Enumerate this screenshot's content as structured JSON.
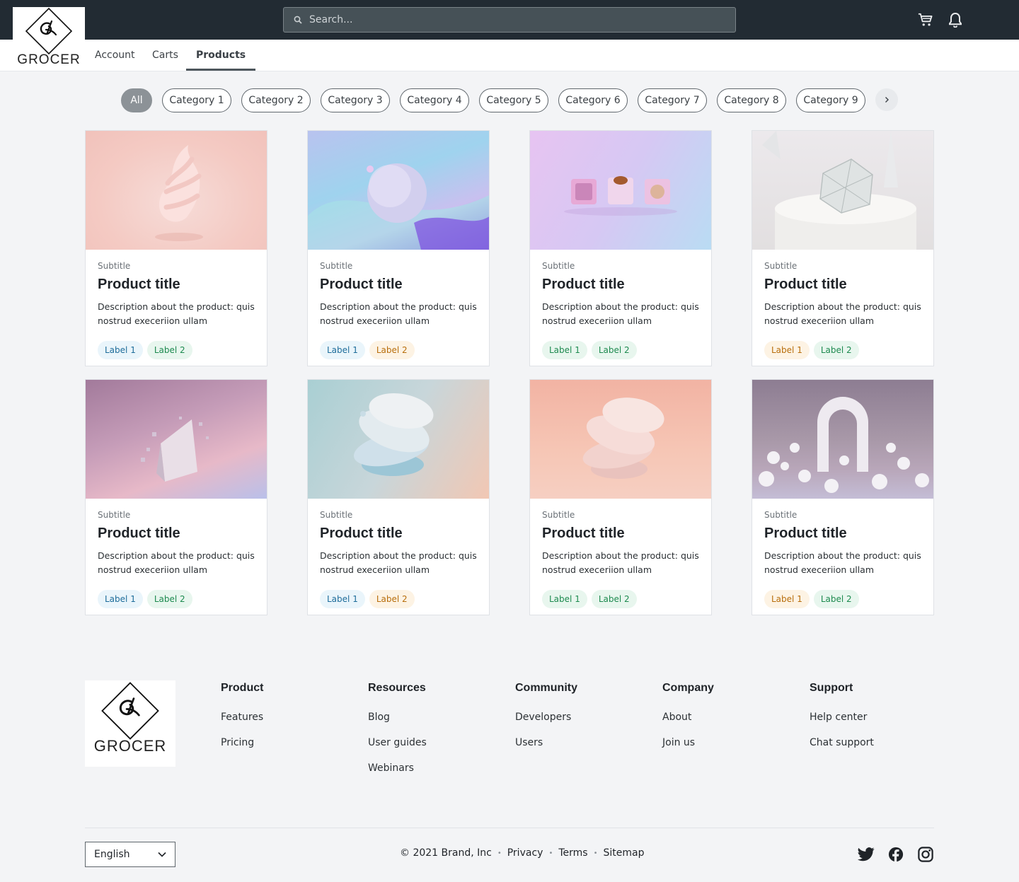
{
  "header": {
    "logo_text": "GROCER",
    "search_placeholder": "Search...",
    "icons": [
      "cart-icon",
      "bell-icon"
    ]
  },
  "nav": {
    "tabs": [
      {
        "label": "Account",
        "active": false
      },
      {
        "label": "Carts",
        "active": false
      },
      {
        "label": "Products",
        "active": true
      }
    ]
  },
  "categories": {
    "items": [
      {
        "label": "All",
        "active": true
      },
      {
        "label": "Category 1"
      },
      {
        "label": "Category 2"
      },
      {
        "label": "Category 3"
      },
      {
        "label": "Category 4"
      },
      {
        "label": "Category 5"
      },
      {
        "label": "Category 6"
      },
      {
        "label": "Category 7"
      },
      {
        "label": "Category 8"
      },
      {
        "label": "Category 9"
      }
    ],
    "next_icon": "chevron-right-icon"
  },
  "products": [
    {
      "subtitle": "Subtitle",
      "title": "Product title",
      "description": "Description about the product: quis nostrud execeriion ullam",
      "labels": [
        {
          "text": "Label 1",
          "color": "blue"
        },
        {
          "text": "Label 2",
          "color": "green"
        }
      ]
    },
    {
      "subtitle": "Subtitle",
      "title": "Product title",
      "description": "Description about the product: quis nostrud execeriion ullam",
      "labels": [
        {
          "text": "Label 1",
          "color": "blue"
        },
        {
          "text": "Label 2",
          "color": "orange"
        }
      ]
    },
    {
      "subtitle": "Subtitle",
      "title": "Product title",
      "description": "Description about the product: quis nostrud execeriion ullam",
      "labels": [
        {
          "text": "Label 1",
          "color": "green"
        },
        {
          "text": "Label 2",
          "color": "green"
        }
      ]
    },
    {
      "subtitle": "Subtitle",
      "title": "Product title",
      "description": "Description about the product: quis nostrud execeriion ullam",
      "labels": [
        {
          "text": "Label 1",
          "color": "orange"
        },
        {
          "text": "Label 2",
          "color": "green"
        }
      ]
    },
    {
      "subtitle": "Subtitle",
      "title": "Product title",
      "description": "Description about the product: quis nostrud execeriion ullam",
      "labels": [
        {
          "text": "Label 1",
          "color": "blue"
        },
        {
          "text": "Label 2",
          "color": "green"
        }
      ]
    },
    {
      "subtitle": "Subtitle",
      "title": "Product title",
      "description": "Description about the product: quis nostrud execeriion ullam",
      "labels": [
        {
          "text": "Label 1",
          "color": "blue"
        },
        {
          "text": "Label 2",
          "color": "orange"
        }
      ]
    },
    {
      "subtitle": "Subtitle",
      "title": "Product title",
      "description": "Description about the product: quis nostrud execeriion ullam",
      "labels": [
        {
          "text": "Label 1",
          "color": "green"
        },
        {
          "text": "Label 2",
          "color": "green"
        }
      ]
    },
    {
      "subtitle": "Subtitle",
      "title": "Product title",
      "description": "Description about the product: quis nostrud execeriion ullam",
      "labels": [
        {
          "text": "Label 1",
          "color": "orange"
        },
        {
          "text": "Label 2",
          "color": "green"
        }
      ]
    }
  ],
  "footer": {
    "logo_text": "GROCER",
    "columns": [
      {
        "heading": "Product",
        "links": [
          "Features",
          "Pricing"
        ]
      },
      {
        "heading": "Resources",
        "links": [
          "Blog",
          "User guides",
          "Webinars"
        ]
      },
      {
        "heading": "Community",
        "links": [
          "Developers",
          "Users"
        ]
      },
      {
        "heading": "Company",
        "links": [
          "About",
          "Join us"
        ]
      },
      {
        "heading": "Support",
        "links": [
          "Help center",
          "Chat support"
        ]
      }
    ],
    "language": "English",
    "copyright": "© 2021 Brand, Inc",
    "legal_links": [
      "Privacy",
      "Terms",
      "Sitemap"
    ],
    "social_icons": [
      "twitter-icon",
      "facebook-icon",
      "instagram-icon"
    ]
  },
  "colors": {
    "header_bg": "#222b33",
    "page_bg": "#f3f4f6",
    "chip_active": "#8c9297"
  }
}
